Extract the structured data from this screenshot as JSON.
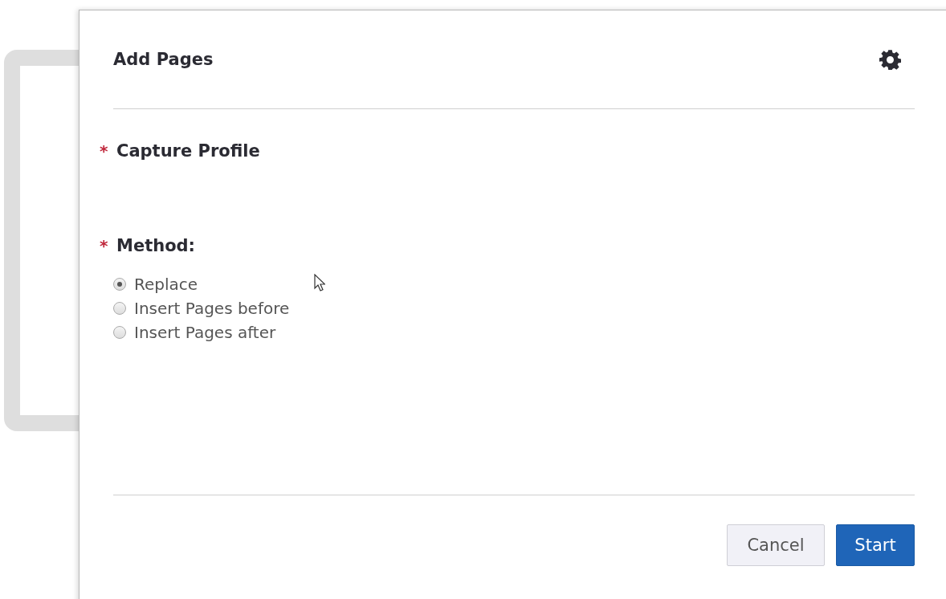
{
  "dialog": {
    "title": "Add Pages"
  },
  "fields": [
    {
      "required_mark": "*",
      "label": "Capture Profile",
      "kind": "empty"
    },
    {
      "required_mark": "*",
      "label": "Method:",
      "kind": "radio",
      "options": [
        {
          "label": "Replace",
          "selected": true
        },
        {
          "label": "Insert Pages before",
          "selected": false
        },
        {
          "label": "Insert Pages after",
          "selected": false
        }
      ]
    }
  ],
  "buttons": [
    {
      "label": "Cancel",
      "kind": "secondary"
    },
    {
      "label": "Start",
      "kind": "primary"
    }
  ]
}
